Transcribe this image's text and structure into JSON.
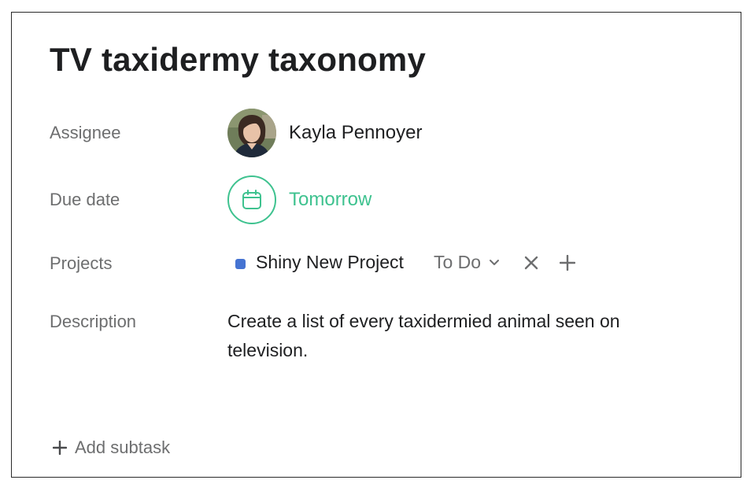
{
  "task": {
    "title": "TV taxidermy taxonomy"
  },
  "fields": {
    "assignee_label": "Assignee",
    "assignee_name": "Kayla Pennoyer",
    "due_label": "Due date",
    "due_value": "Tomorrow",
    "projects_label": "Projects",
    "project_name": "Shiny New Project",
    "project_color": "#4573d2",
    "section_value": "To Do",
    "description_label": "Description",
    "description_text": "Create a list of every taxidermied animal seen on television."
  },
  "footer": {
    "add_subtask_label": "Add subtask"
  },
  "icons": {
    "calendar": "calendar-icon",
    "chevron": "chevron-down-icon",
    "remove": "close-icon",
    "add": "plus-icon"
  },
  "colors": {
    "accent_green": "#3ec28f",
    "text_primary": "#1e1f21",
    "text_secondary": "#6d6e6f"
  }
}
